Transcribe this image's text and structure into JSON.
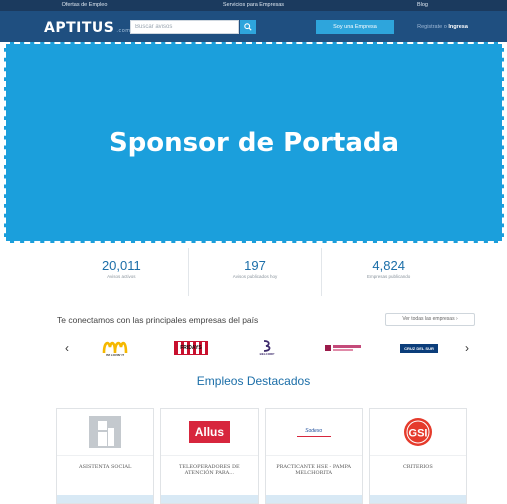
{
  "top_nav": {
    "items": [
      {
        "label": "Ofertas de Empleo"
      },
      {
        "label": "Servicios para Empresas"
      },
      {
        "label": "Blog"
      }
    ]
  },
  "header": {
    "logo_text": "APTITUS",
    "logo_suffix": ".com",
    "search_placeholder": "Buscar avisos",
    "company_button": "Soy una Empresa",
    "register": "Registrate",
    "or": "o",
    "login": "Ingresa",
    "colors": {
      "bar": "#1f4f80",
      "accent": "#2ea5dc"
    }
  },
  "sponsor": {
    "text": "Sponsor de Portada",
    "color": "#1b9fdc"
  },
  "stats": [
    {
      "value": "20,011",
      "label": "Avisos activos"
    },
    {
      "value": "197",
      "label": "Avisos publicados hoy"
    },
    {
      "value": "4,824",
      "label": "Empresas publicando"
    }
  ],
  "companies": {
    "title": "Te conectamos con las principales empresas del país",
    "view_all": "Ver todas las empresas",
    "logos": [
      {
        "name": "McDonald's",
        "caption": "I'M LOVIN' IT"
      },
      {
        "name": "TGI Fridays",
        "caption": "FRIDAYS"
      },
      {
        "name": "Belcorp",
        "caption": "BELCORP"
      },
      {
        "name": "Tottus",
        "caption": ""
      },
      {
        "name": "Cruz del Sur",
        "caption": "CRUZ DEL SUR"
      }
    ]
  },
  "featured": {
    "title": "Empleos Destacados",
    "jobs": [
      {
        "title": "ASISTENTA SOCIAL",
        "logo": "placeholder-person"
      },
      {
        "title": "TELEOPERADORES DE ATENCIÓN PARA...",
        "logo": "Allus"
      },
      {
        "title": "PRACTICANTE HSE - PAMPA MELCHORITA",
        "logo": "Sodexo"
      },
      {
        "title": "CRITERIOS",
        "logo": "GSI"
      }
    ]
  }
}
